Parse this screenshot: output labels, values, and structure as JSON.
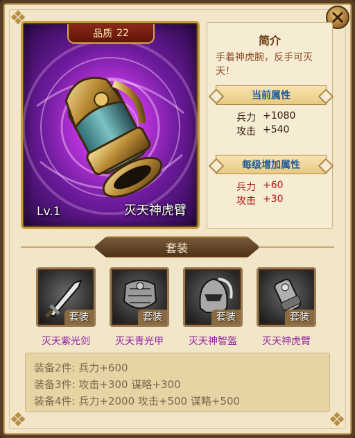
{
  "item": {
    "quality_label": "品质",
    "quality_value": "22",
    "level": "Lv.1",
    "name": "灭天神虎臂"
  },
  "info": {
    "title": "简介",
    "description": "手着神虎腕，反手可灭天！",
    "current_header": "当前属性",
    "current_stats": [
      {
        "label": "兵力",
        "value": "+1080"
      },
      {
        "label": "攻击",
        "value": "+540"
      }
    ],
    "growth_header": "每级增加属性",
    "growth_stats": [
      {
        "label": "兵力",
        "value": "+60"
      },
      {
        "label": "攻击",
        "value": "+30"
      }
    ]
  },
  "set": {
    "title": "套装",
    "tag": "套装",
    "items": [
      {
        "name": "灭天紫光剑",
        "icon": "sword-icon"
      },
      {
        "name": "灭天青光甲",
        "icon": "armor-icon"
      },
      {
        "name": "灭天神智盔",
        "icon": "helmet-icon"
      },
      {
        "name": "灭天神虎臂",
        "icon": "bracer-icon"
      }
    ],
    "bonuses": [
      "装备2件: 兵力+600",
      "装备3件: 攻击+300 谋略+300",
      "装备4件: 兵力+2000 攻击+500 谋略+500"
    ]
  },
  "colors": {
    "panel_bg": "#f2e6c8",
    "frame": "#5a3e22",
    "set_name_purple": "#8e1f9e",
    "growth_red": "#b01414",
    "header_blue": "#1c5a9e"
  }
}
